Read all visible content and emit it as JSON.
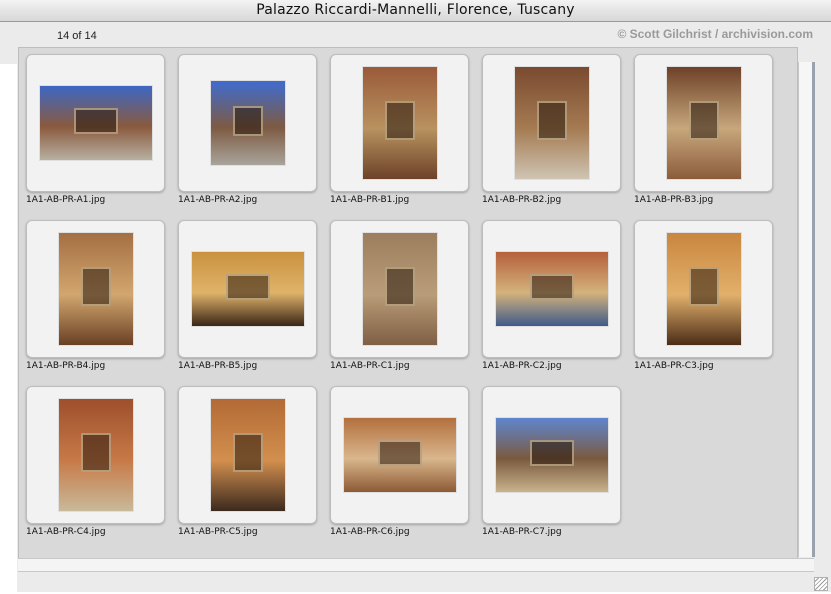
{
  "window": {
    "title": "Palazzo Riccardi-Mannelli, Florence, Tuscany"
  },
  "toolbar": {
    "counter": "14 of 14",
    "credit": "© Scott Gilchrist / archivision.com"
  },
  "images": [
    {
      "filename": "1A1-AB-PR-A1.jpg",
      "colors": [
        "#3e67c4",
        "#8a5a3d",
        "#b8b0a2"
      ]
    },
    {
      "filename": "1A1-AB-PR-A2.jpg",
      "colors": [
        "#3f6cd0",
        "#7d5a42",
        "#a9a49b"
      ]
    },
    {
      "filename": "1A1-AB-PR-B1.jpg",
      "colors": [
        "#9a5a3a",
        "#b8925f",
        "#6d4229"
      ]
    },
    {
      "filename": "1A1-AB-PR-B2.jpg",
      "colors": [
        "#7a4a30",
        "#a57b52",
        "#cfc4b3"
      ]
    },
    {
      "filename": "1A1-AB-PR-B3.jpg",
      "colors": [
        "#6e4128",
        "#c7a77c",
        "#8b5c3b"
      ]
    },
    {
      "filename": "1A1-AB-PR-B4.jpg",
      "colors": [
        "#a46f43",
        "#d2a66e",
        "#6a4025"
      ]
    },
    {
      "filename": "1A1-AB-PR-B5.jpg",
      "colors": [
        "#c9923f",
        "#e0b36a",
        "#3a2616"
      ]
    },
    {
      "filename": "1A1-AB-PR-C1.jpg",
      "colors": [
        "#9c7e5e",
        "#b99c78",
        "#7f5f44"
      ]
    },
    {
      "filename": "1A1-AB-PR-C2.jpg",
      "colors": [
        "#b5603b",
        "#d4b27c",
        "#3f5b8a"
      ]
    },
    {
      "filename": "1A1-AB-PR-C3.jpg",
      "colors": [
        "#c9863f",
        "#e2b06a",
        "#4a2c18"
      ]
    },
    {
      "filename": "1A1-AB-PR-C4.jpg",
      "colors": [
        "#9e4f2c",
        "#c77a47",
        "#c9b99a"
      ]
    },
    {
      "filename": "1A1-AB-PR-C5.jpg",
      "colors": [
        "#b36a36",
        "#d28f4e",
        "#3b2a1e"
      ]
    },
    {
      "filename": "1A1-AB-PR-C6.jpg",
      "colors": [
        "#b3703e",
        "#d9b68d",
        "#8c5a34"
      ]
    },
    {
      "filename": "1A1-AB-PR-C7.jpg",
      "colors": [
        "#5f86cf",
        "#7a5a3e",
        "#c9b38c"
      ]
    }
  ]
}
